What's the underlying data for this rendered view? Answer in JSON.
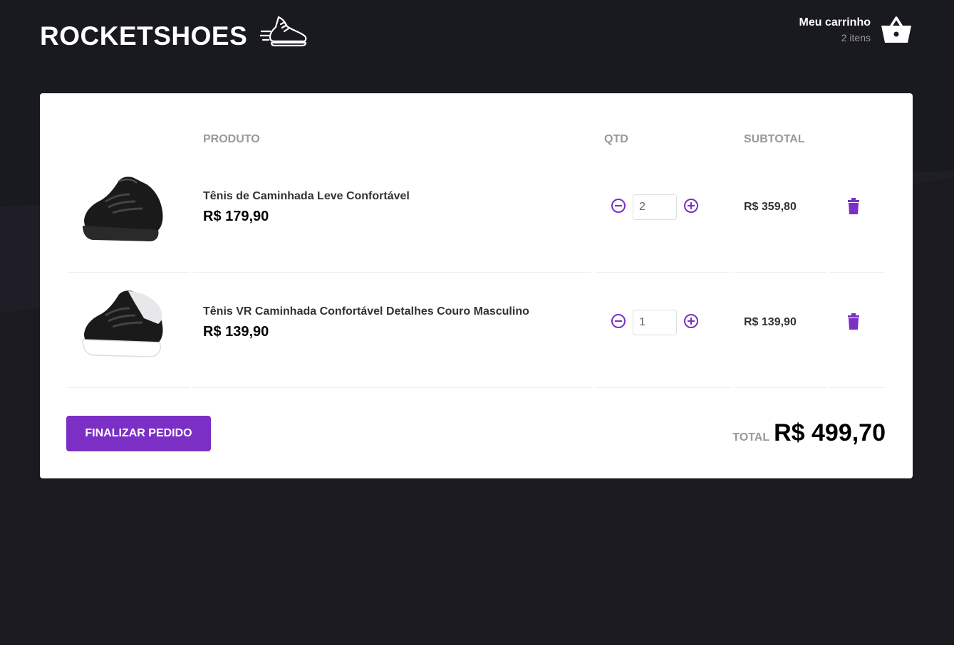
{
  "header": {
    "logo_text": "ROCKETSHOES",
    "cart_title": "Meu carrinho",
    "cart_count": "2 itens"
  },
  "table": {
    "headers": [
      "PRODUTO",
      "QTD",
      "SUBTOTAL"
    ],
    "items": [
      {
        "title": "Tênis de Caminhada Leve Confortável",
        "price": "R$ 179,90",
        "quantity": "2",
        "subtotal": "R$ 359,80",
        "shoe_sole_color": "#1a1a1a"
      },
      {
        "title": "Tênis VR Caminhada Confortável Detalhes Couro Masculino",
        "price": "R$ 139,90",
        "quantity": "1",
        "subtotal": "R$ 139,90",
        "shoe_sole_color": "#ffffff"
      }
    ]
  },
  "footer": {
    "checkout_label": "FINALIZAR PEDIDO",
    "total_label": "TOTAL",
    "total_value": "R$ 499,70"
  },
  "colors": {
    "background": "#191920",
    "accent": "#7b2fc4",
    "card": "#ffffff"
  },
  "icons": {
    "logo": "running-shoe-icon",
    "cart": "basket-icon",
    "decrement": "minus-circle-icon",
    "increment": "plus-circle-icon",
    "remove": "trash-icon"
  }
}
